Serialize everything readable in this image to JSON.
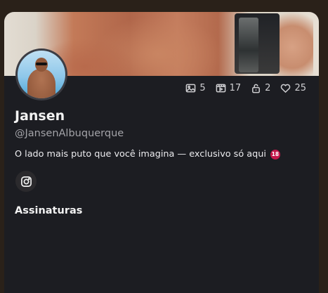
{
  "profile": {
    "name": "Jansen",
    "handle": "@JansenAlbuquerque",
    "bio": "O lado mais puto que você imagina — exclusivo só aqui",
    "bio_badge": "18",
    "accent_color": "#c4164a"
  },
  "stats": {
    "photos": "5",
    "videos": "17",
    "locked": "2",
    "likes": "25"
  },
  "icons": {
    "photos": "image-icon",
    "videos": "video-icon",
    "locked": "lock-icon",
    "likes": "heart-icon",
    "social": "instagram-icon"
  },
  "sections": {
    "subscriptions_title": "Assinaturas"
  }
}
